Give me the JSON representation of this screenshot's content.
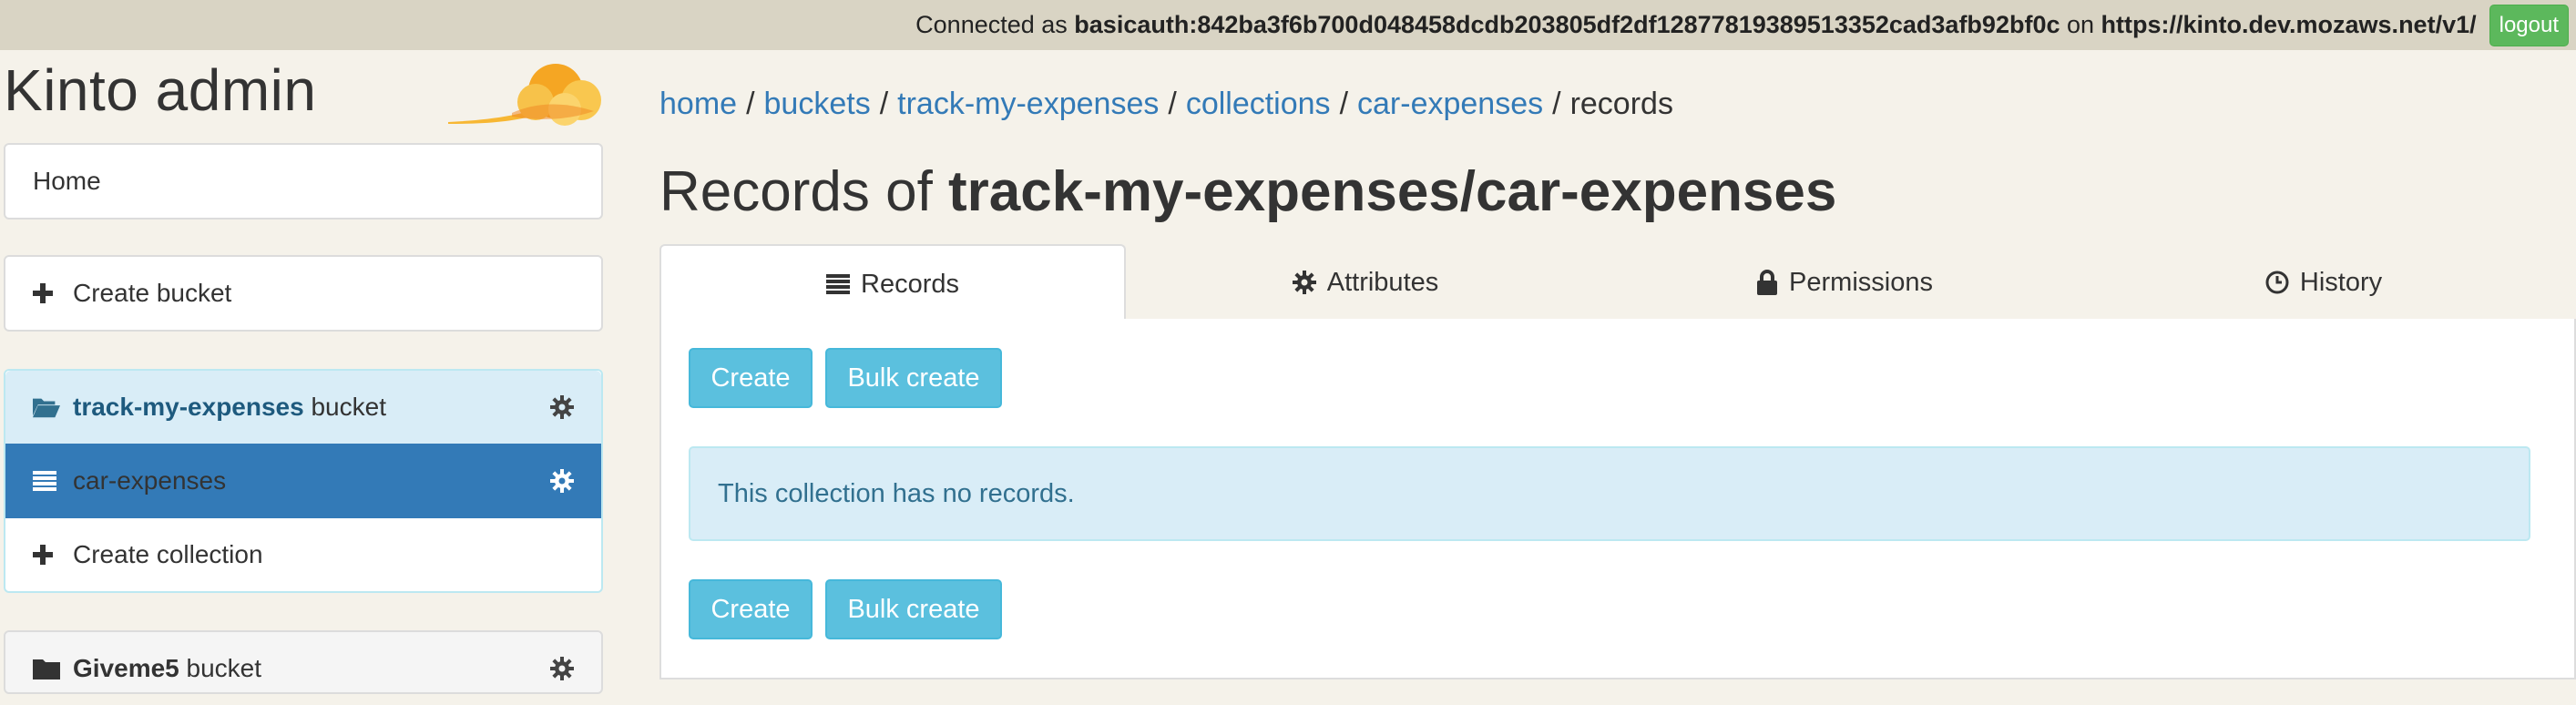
{
  "topbar": {
    "connected_prefix": "Connected as ",
    "user": "basicauth:842ba3f6b700d048458dcdb203805df2df12877819389513352cad3afb92bf0c",
    "on": " on ",
    "server": "https://kinto.dev.mozaws.net/v1/",
    "logout_label": "logout"
  },
  "sidebar": {
    "brand": "Kinto admin",
    "home_label": "Home",
    "create_bucket_label": "Create bucket",
    "buckets": [
      {
        "name": "track-my-expenses",
        "suffix": " bucket",
        "collections": [
          {
            "name": "car-expenses",
            "active": true
          }
        ],
        "create_collection_label": "Create collection"
      },
      {
        "name": "Giveme5",
        "suffix": " bucket"
      }
    ]
  },
  "breadcrumb": {
    "items": [
      "home",
      "buckets",
      "track-my-expenses",
      "collections",
      "car-expenses"
    ],
    "current": "records",
    "separator": "/"
  },
  "main": {
    "title_prefix": "Records of ",
    "title_bold": "track-my-expenses/car-expenses",
    "tabs": [
      {
        "label": "Records",
        "icon": "list-icon",
        "active": true
      },
      {
        "label": "Attributes",
        "icon": "gear-icon"
      },
      {
        "label": "Permissions",
        "icon": "lock-icon"
      },
      {
        "label": "History",
        "icon": "clock-icon"
      }
    ],
    "create_label": "Create",
    "bulk_create_label": "Bulk create",
    "empty_message": "This collection has no records."
  },
  "colors": {
    "topbar_bg": "#d9d4c4",
    "page_bg": "#f5f2ea",
    "link": "#337ab7",
    "info_button": "#5bc0de",
    "logout_button": "#5cb85c",
    "active_item": "#337ab7",
    "bucket_head": "#d9edf7"
  }
}
